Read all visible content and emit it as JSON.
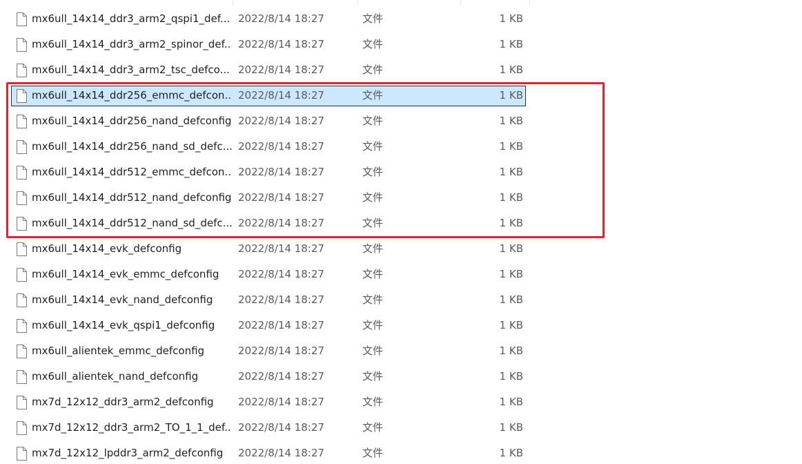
{
  "files": [
    {
      "name": "mx6ull_14x14_ddr3_arm2_qspi1_def...",
      "date": "2022/8/14 18:27",
      "type": "文件",
      "size": "1 KB",
      "selected": false
    },
    {
      "name": "mx6ull_14x14_ddr3_arm2_spinor_def...",
      "date": "2022/8/14 18:27",
      "type": "文件",
      "size": "1 KB",
      "selected": false
    },
    {
      "name": "mx6ull_14x14_ddr3_arm2_tsc_defco...",
      "date": "2022/8/14 18:27",
      "type": "文件",
      "size": "1 KB",
      "selected": false
    },
    {
      "name": "mx6ull_14x14_ddr256_emmc_defcon...",
      "date": "2022/8/14 18:27",
      "type": "文件",
      "size": "1 KB",
      "selected": true
    },
    {
      "name": "mx6ull_14x14_ddr256_nand_defconfig",
      "date": "2022/8/14 18:27",
      "type": "文件",
      "size": "1 KB",
      "selected": false
    },
    {
      "name": "mx6ull_14x14_ddr256_nand_sd_defc...",
      "date": "2022/8/14 18:27",
      "type": "文件",
      "size": "1 KB",
      "selected": false
    },
    {
      "name": "mx6ull_14x14_ddr512_emmc_defcon...",
      "date": "2022/8/14 18:27",
      "type": "文件",
      "size": "1 KB",
      "selected": false
    },
    {
      "name": "mx6ull_14x14_ddr512_nand_defconfig",
      "date": "2022/8/14 18:27",
      "type": "文件",
      "size": "1 KB",
      "selected": false
    },
    {
      "name": "mx6ull_14x14_ddr512_nand_sd_defc...",
      "date": "2022/8/14 18:27",
      "type": "文件",
      "size": "1 KB",
      "selected": false
    },
    {
      "name": "mx6ull_14x14_evk_defconfig",
      "date": "2022/8/14 18:27",
      "type": "文件",
      "size": "1 KB",
      "selected": false
    },
    {
      "name": "mx6ull_14x14_evk_emmc_defconfig",
      "date": "2022/8/14 18:27",
      "type": "文件",
      "size": "1 KB",
      "selected": false
    },
    {
      "name": "mx6ull_14x14_evk_nand_defconfig",
      "date": "2022/8/14 18:27",
      "type": "文件",
      "size": "1 KB",
      "selected": false
    },
    {
      "name": "mx6ull_14x14_evk_qspi1_defconfig",
      "date": "2022/8/14 18:27",
      "type": "文件",
      "size": "1 KB",
      "selected": false
    },
    {
      "name": "mx6ull_alientek_emmc_defconfig",
      "date": "2022/8/14 18:27",
      "type": "文件",
      "size": "1 KB",
      "selected": false
    },
    {
      "name": "mx6ull_alientek_nand_defconfig",
      "date": "2022/8/14 18:27",
      "type": "文件",
      "size": "1 KB",
      "selected": false
    },
    {
      "name": "mx7d_12x12_ddr3_arm2_defconfig",
      "date": "2022/8/14 18:27",
      "type": "文件",
      "size": "1 KB",
      "selected": false
    },
    {
      "name": "mx7d_12x12_ddr3_arm2_TO_1_1_def...",
      "date": "2022/8/14 18:27",
      "type": "文件",
      "size": "1 KB",
      "selected": false
    },
    {
      "name": "mx7d_12x12_lpddr3_arm2_defconfig",
      "date": "2022/8/14 18:27",
      "type": "文件",
      "size": "1 KB",
      "selected": false
    }
  ],
  "icons": {
    "file": "file-icon"
  },
  "colors": {
    "selection_background": "#cce8ff",
    "highlight_border": "#e0232e"
  }
}
